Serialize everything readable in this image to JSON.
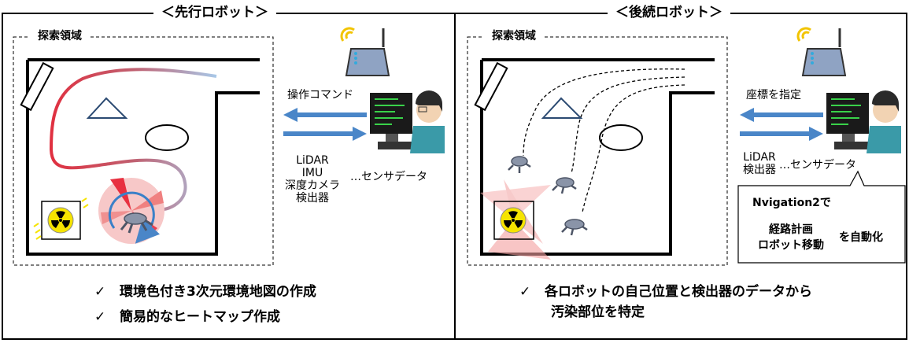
{
  "left": {
    "title": "＜先行ロボット＞",
    "area_label": "探索領域",
    "cmd_label": "操作コマンド",
    "sensor_list": [
      "LiDAR",
      "IMU",
      "深度カメラ",
      "検出器"
    ],
    "sensor_suffix": "…センサデータ",
    "bullets": [
      "環境色付き3次元環境地図の作成",
      "簡易的なヒートマップ作成"
    ],
    "check_mark": "✓"
  },
  "right": {
    "title": "＜後続ロボット＞",
    "area_label": "探索領域",
    "cmd_label": "座標を指定",
    "sensor_list": [
      "LiDAR",
      "検出器"
    ],
    "sensor_suffix": "…センサデータ",
    "callout_line1": "Nvigation2で",
    "callout_line2a": "経路計画",
    "callout_line2b": "ロボット移動",
    "callout_line3": "を自動化",
    "bullet_line1": "各ロボットの自己位置と検出器のデータから",
    "bullet_line2": "汚染部位を特定",
    "check_mark": "✓"
  },
  "colors": {
    "arrow_blue": "#4a86c8",
    "trail_red": "#e03040",
    "trail_blue": "#a8c8e8",
    "radiation_yellow": "#f6e400",
    "heat_pink": "#f7b6b6"
  },
  "icons": [
    "wifi-router-icon",
    "operator-computer-icon",
    "radiation-icon",
    "quadruped-robot-icon"
  ]
}
